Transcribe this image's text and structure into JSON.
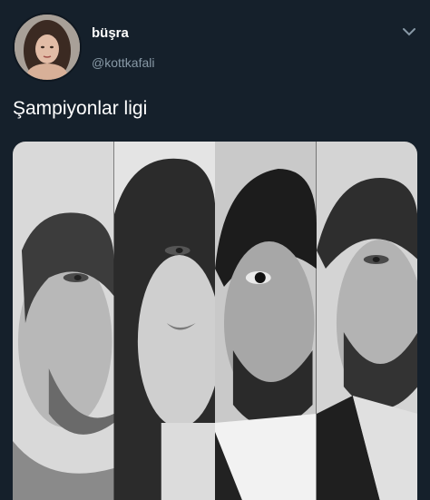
{
  "tweet": {
    "author_name": "büşra",
    "author_handle": "@kottkafali",
    "text": "Şampiyonlar ligi",
    "icons": {
      "avatar": "profile-photo",
      "menu": "chevron-down-icon"
    }
  },
  "media": {
    "panels": [
      "man-portrait-1",
      "woman-portrait",
      "man-portrait-2",
      "man-portrait-3"
    ]
  },
  "colors": {
    "background": "#15202b",
    "text": "#ffffff",
    "secondary_text": "#8899a6"
  }
}
